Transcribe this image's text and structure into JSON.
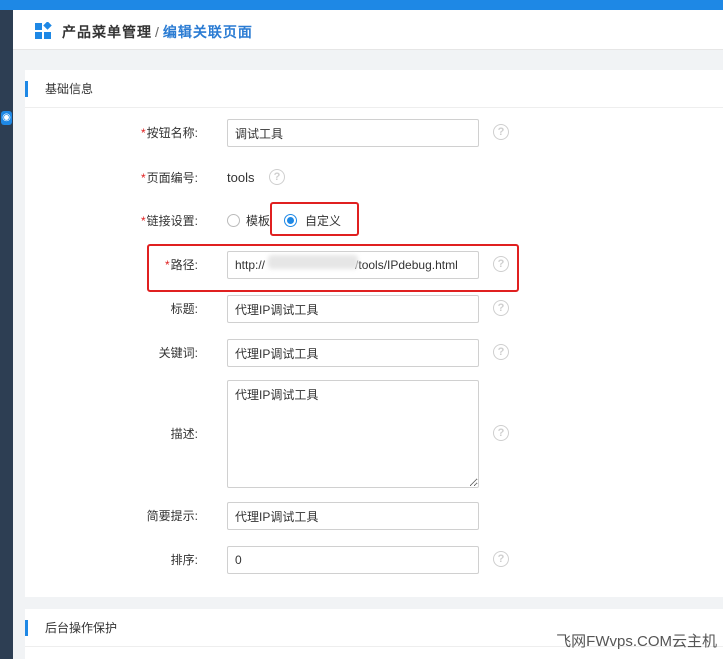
{
  "breadcrumb": {
    "parent": "产品菜单管理",
    "separator": "/",
    "current": "编辑关联页面"
  },
  "left_indicator_icon": "circle-dot-icon",
  "section_basic": {
    "title": "基础信息",
    "fields": {
      "button_name": {
        "label": "按钮名称:",
        "value": "调试工具"
      },
      "page_code": {
        "label": "页面编号:",
        "value": "tools"
      },
      "link_setting": {
        "label": "链接设置:",
        "options": [
          "模板",
          "自定义"
        ],
        "selected": "自定义"
      },
      "path": {
        "label": "路径:",
        "value_prefix": "http://",
        "value_suffix": "/tools/IPdebug.html"
      },
      "title": {
        "label": "标题:",
        "value": "代理IP调试工具"
      },
      "keywords": {
        "label": "关键词:",
        "value": "代理IP调试工具"
      },
      "description": {
        "label": "描述:",
        "value": "代理IP调试工具"
      },
      "hint": {
        "label": "简要提示:",
        "value": "代理IP调试工具"
      },
      "order": {
        "label": "排序:",
        "value": "0"
      }
    },
    "required_mark": "*",
    "help_glyph": "?"
  },
  "section_protect": {
    "title": "后台操作保护"
  },
  "watermark": "飞网FWvps.COM云主机",
  "colors": {
    "accent": "#1e88e5",
    "breadcrumb_current": "#2b7cd3",
    "required": "#e02020",
    "highlight_box": "#e02020"
  }
}
